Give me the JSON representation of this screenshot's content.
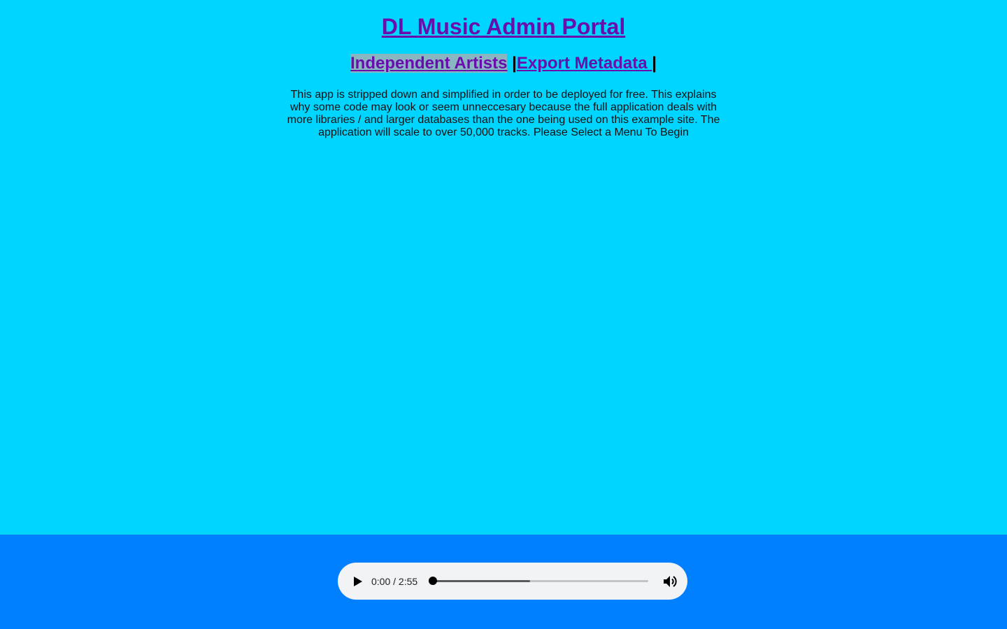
{
  "header": {
    "title": "DL Music Admin Portal"
  },
  "nav": {
    "items": [
      {
        "label": "Independent Artists",
        "active": true
      },
      {
        "label": "Export Metadata ",
        "active": false
      }
    ],
    "separator": "|"
  },
  "intro": {
    "text": "This app is stripped down and simplified in order to be deployed for free. This explains why some code may look or seem unneccesary because the full application deals with more libraries / and larger databases than the one being used on this example site. The application will scale to over 50,000 tracks. Please Select a Menu To Begin"
  },
  "player": {
    "time_display": "0:00 / 2:55",
    "progress": 0.0,
    "buffered": 0.45,
    "play_icon": "play-icon",
    "volume_icon": "volume-icon"
  },
  "colors": {
    "page_bg": "#00d5ff",
    "footer_bg": "#0080ff",
    "link": "#6a0dad",
    "active_highlight": "#8ab6c2",
    "player_bg": "#f1f3f4"
  }
}
